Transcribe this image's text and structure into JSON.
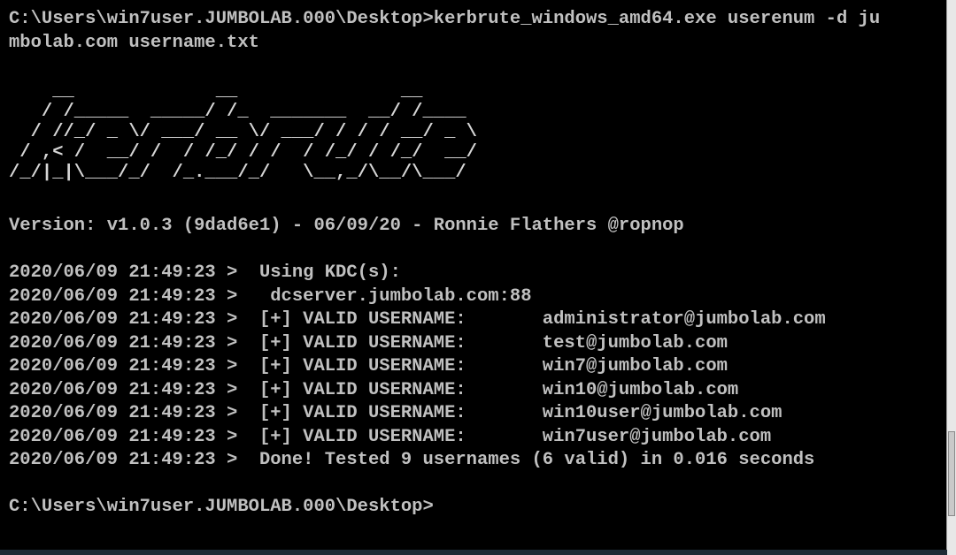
{
  "console": {
    "command_line_1": "C:\\Users\\win7user.JUMBOLAB.000\\Desktop>kerbrute_windows_amd64.exe userenum -d ju",
    "command_line_2": "mbolab.com username.txt",
    "banner": "    __             __               __\n   / /_____  _____/ /_  _______  __/ /____\n  / //_/ _ \\/ ___/ __ \\/ ___/ / / / __/ _ \\\n / ,< /  __/ /  / /_/ / /  / /_/ / /_/  __/\n/_/|_|\\___/_/  /_.___/_/   \\__,_/\\__/\\___/",
    "version": "Version: v1.0.3 (9dad6e1) - 06/09/20 - Ronnie Flathers @ropnop",
    "output": [
      "2020/06/09 21:49:23 >  Using KDC(s):",
      "2020/06/09 21:49:23 >   dcserver.jumbolab.com:88",
      "2020/06/09 21:49:23 >  [+] VALID USERNAME:       administrator@jumbolab.com",
      "2020/06/09 21:49:23 >  [+] VALID USERNAME:       test@jumbolab.com",
      "2020/06/09 21:49:23 >  [+] VALID USERNAME:       win7@jumbolab.com",
      "2020/06/09 21:49:23 >  [+] VALID USERNAME:       win10@jumbolab.com",
      "2020/06/09 21:49:23 >  [+] VALID USERNAME:       win10user@jumbolab.com",
      "2020/06/09 21:49:23 >  [+] VALID USERNAME:       win7user@jumbolab.com",
      "2020/06/09 21:49:23 >  Done! Tested 9 usernames (6 valid) in 0.016 seconds"
    ],
    "prompt": "C:\\Users\\win7user.JUMBOLAB.000\\Desktop>"
  },
  "colors": {
    "background": "#000000",
    "text": "#c0c0c0"
  }
}
